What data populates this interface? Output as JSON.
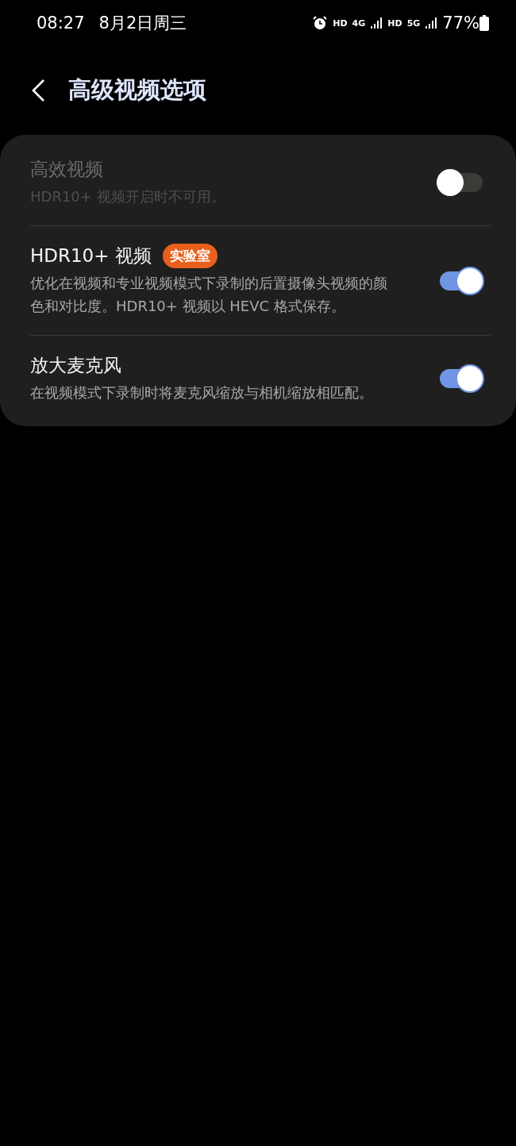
{
  "status_bar": {
    "time": "08:27",
    "date": "8月2日周三",
    "indicators": [
      "HD",
      "4G",
      "HD",
      "5G"
    ],
    "battery": "77%"
  },
  "header": {
    "title": "高级视频选项"
  },
  "items": [
    {
      "title": "高效视频",
      "description": "HDR10+ 视频开启时不可用。",
      "disabled": true,
      "on": false
    },
    {
      "title": "HDR10+ 视频",
      "badge": "实验室",
      "description": "优化在视频和专业视频模式下录制的后置摄像头视频的颜色和对比度。HDR10+ 视频以 HEVC 格式保存。",
      "disabled": false,
      "on": true
    },
    {
      "title": "放大麦克风",
      "description": "在视频模式下录制时将麦克风缩放与相机缩放相匹配。",
      "disabled": false,
      "on": true
    }
  ]
}
